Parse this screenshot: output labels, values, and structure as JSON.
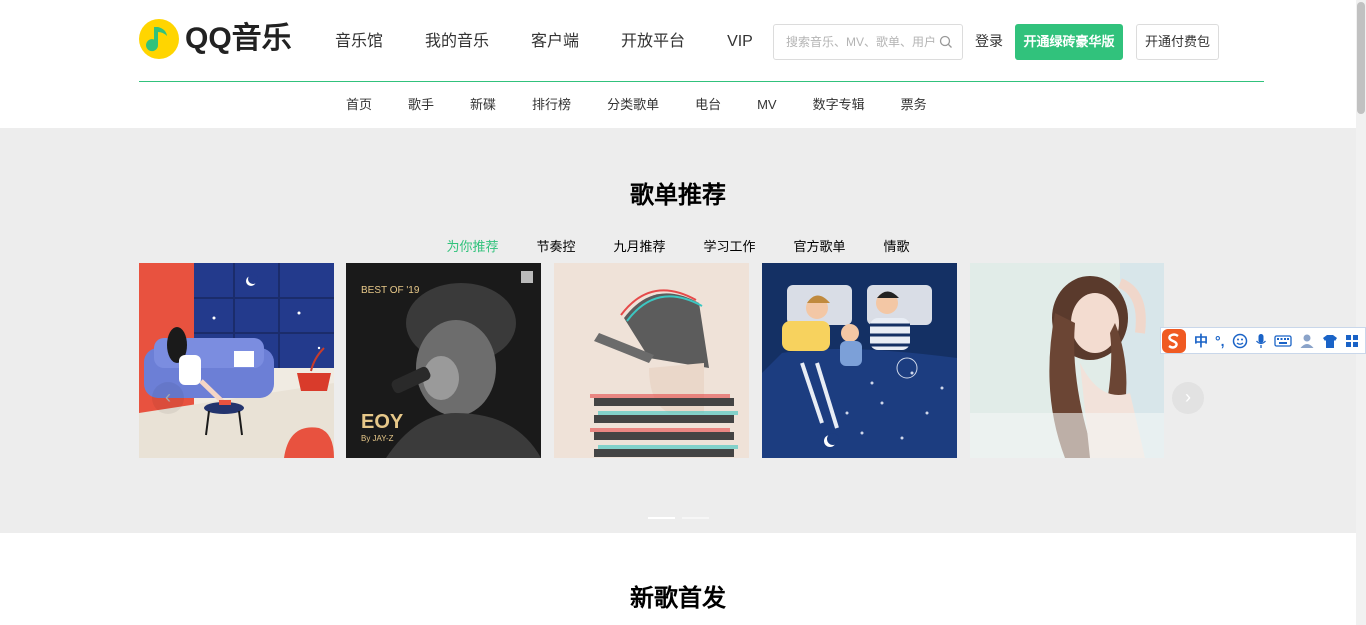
{
  "brand": {
    "name": "QQ音乐",
    "accent": "#31c27c"
  },
  "main_nav": [
    "音乐馆",
    "我的音乐",
    "客户端",
    "开放平台",
    "VIP"
  ],
  "search": {
    "placeholder": "搜索音乐、MV、歌单、用户"
  },
  "header": {
    "login": "登录",
    "vip_button": "开通绿砖豪华版",
    "pay_button": "开通付费包"
  },
  "sub_nav": [
    "首页",
    "歌手",
    "新碟",
    "排行榜",
    "分类歌单",
    "电台",
    "MV",
    "数字专辑",
    "票务"
  ],
  "playlist": {
    "title": "歌单推荐",
    "tabs": [
      "为你推荐",
      "节奏控",
      "九月推荐",
      "学习工作",
      "官方歌单",
      "情歌"
    ],
    "active_tab": 0,
    "cover2_text": {
      "tag": "BEST OF '19",
      "title": "EOY",
      "by": "By JAY-Z"
    }
  },
  "newsong": {
    "title": "新歌首发"
  },
  "ime": {
    "lang": "中",
    "punct": "°,"
  }
}
